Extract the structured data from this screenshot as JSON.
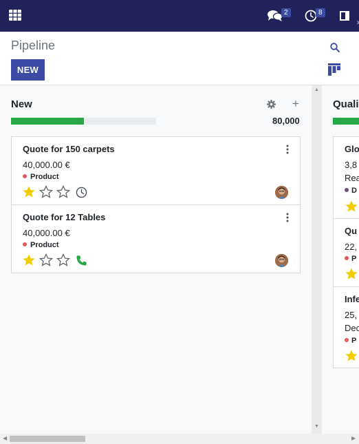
{
  "navbar": {
    "apps_icon": "grid-icon",
    "messages_count": "2",
    "activities_count": "8",
    "bg_color": "#22225a"
  },
  "control_panel": {
    "title": "Pipeline",
    "new_label": "NEW"
  },
  "columns": [
    {
      "title": "New",
      "total": "80,000",
      "progress_fraction": 0.5,
      "cards": [
        {
          "title": "Quote for 150 carpets",
          "amount": "40,000.00 €",
          "tag": "Product",
          "tag_color": "#e25a5a",
          "stars": 1,
          "activity_icon": "clock-icon"
        },
        {
          "title": "Quote for 12 Tables",
          "amount": "40,000.00 €",
          "tag": "Product",
          "tag_color": "#e25a5a",
          "stars": 1,
          "activity_icon": "phone-icon"
        }
      ]
    },
    {
      "title": "Quali",
      "cards": [
        {
          "title": "Glo",
          "amount": "3,8",
          "subtitle": "Rea",
          "tag": "D",
          "tag_color": "#6f4e7c"
        },
        {
          "title": "Qu",
          "amount": "22,",
          "tag": "P",
          "tag_color": "#e25a5a"
        },
        {
          "title": "Infe",
          "amount": "25,",
          "subtitle": "Dec",
          "tag": "P",
          "tag_color": "#e25a5a"
        }
      ]
    }
  ],
  "colors": {
    "accent": "#3c4aa6",
    "progress": "#28a745",
    "star": "#f3cc00",
    "phone": "#28a745"
  }
}
